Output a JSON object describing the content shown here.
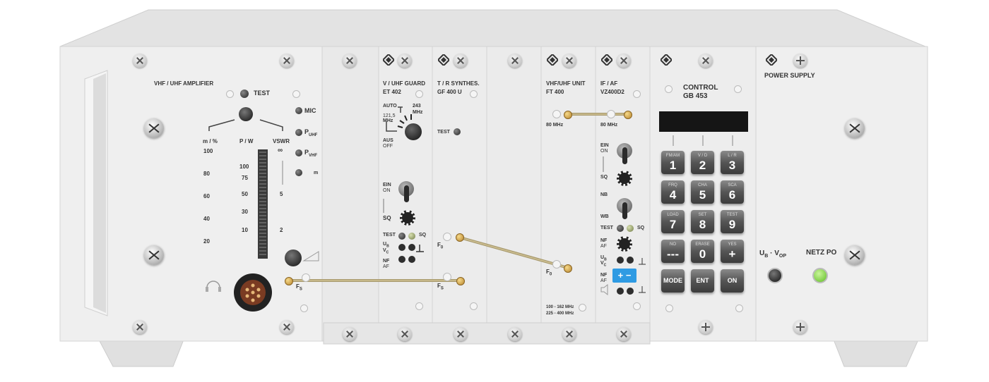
{
  "amplifier": {
    "title": "VHF / UHF AMPLIFIER",
    "test_label": "TEST",
    "mic_label": "MIC",
    "p_uhf": {
      "main": "P",
      "sub": "UHF"
    },
    "p_vhf": {
      "main": "P",
      "sub": "VHF"
    },
    "m_label": "m",
    "scale_headers": [
      "m / %",
      "P / W",
      "VSWR"
    ],
    "m_scale": [
      "100",
      "80",
      "60",
      "40",
      "20"
    ],
    "pw_scale": [
      "100",
      "75",
      "50",
      "30",
      "10"
    ],
    "vswr_scale": [
      "∞",
      "5",
      "2"
    ],
    "fs_label": {
      "main": "F",
      "sub": "S"
    }
  },
  "guard": {
    "title_line1": "V / UHF GUARD",
    "title_line2": "ET 402",
    "auto": "AUTO",
    "f121": "121,5",
    "f121_unit": "MHz",
    "f243": "243",
    "f243_unit": "MHz",
    "aus": "AUS",
    "off": "OFF",
    "ein": "EIN",
    "on": "ON",
    "sq": "SQ",
    "test": "TEST",
    "sq2": "SQ",
    "ub": {
      "main": "U",
      "sub": "B"
    },
    "vc": {
      "main": "V",
      "sub": "C"
    },
    "nf": "NF",
    "af": "AF"
  },
  "synth": {
    "title_line1": "T / R SYNTHES.",
    "title_line2": "GF 400 U",
    "test": "TEST",
    "f0": {
      "main": "F",
      "sub": "0"
    },
    "fs": {
      "main": "F",
      "sub": "S"
    }
  },
  "unit": {
    "title_line1": "VHF/UHF UNIT",
    "title_line2": "FT 400",
    "mhz80": "80 MHz",
    "f0": {
      "main": "F",
      "sub": "0"
    },
    "range1": "100 - 162 MHz",
    "range2": "225 - 400 MHz"
  },
  "ifaf": {
    "title_line1": "IF / AF",
    "title_line2": "VZ400D2",
    "mhz80": "80 MHz",
    "ein": "EIN",
    "on": "ON",
    "sq": "SQ",
    "nb": "NB",
    "wb": "WB",
    "test": "TEST",
    "sq2": "SQ",
    "nf": "NF",
    "af": "AF",
    "ub": {
      "main": "U",
      "sub": "B"
    },
    "vc": {
      "main": "V",
      "sub": "C"
    },
    "nf2": "NF",
    "af2": "AF",
    "vol_plus": "+",
    "vol_minus": "−"
  },
  "control": {
    "title_line1": "CONTROL",
    "title_line2": "GB 453",
    "keys": [
      {
        "top": "FM/AM",
        "num": "1"
      },
      {
        "top": "V / D",
        "num": "2"
      },
      {
        "top": "L / R",
        "num": "3"
      },
      {
        "top": "FRQ",
        "num": "4"
      },
      {
        "top": "CHA",
        "num": "5"
      },
      {
        "top": "SCA",
        "num": "6"
      },
      {
        "top": "LOAD",
        "num": "7"
      },
      {
        "top": "SET",
        "num": "8"
      },
      {
        "top": "TEST",
        "num": "9"
      },
      {
        "top": "NO",
        "num": "---"
      },
      {
        "top": "ERASE",
        "num": "0"
      },
      {
        "top": "YES",
        "num": "+"
      }
    ],
    "mode": "MODE",
    "ent": "ENT",
    "on": "ON"
  },
  "power": {
    "title": "POWER SUPPLY",
    "ub": "U",
    "ub_sub": "B",
    "dot": "·",
    "vop": "V",
    "vop_sub": "OP",
    "netz": "NETZ PO"
  },
  "colors": {
    "panel": "#ededed",
    "cable": "#b8a77a",
    "led_green": "#7fd43a",
    "display": "#151515",
    "vol_blue": "#2f9be3"
  }
}
